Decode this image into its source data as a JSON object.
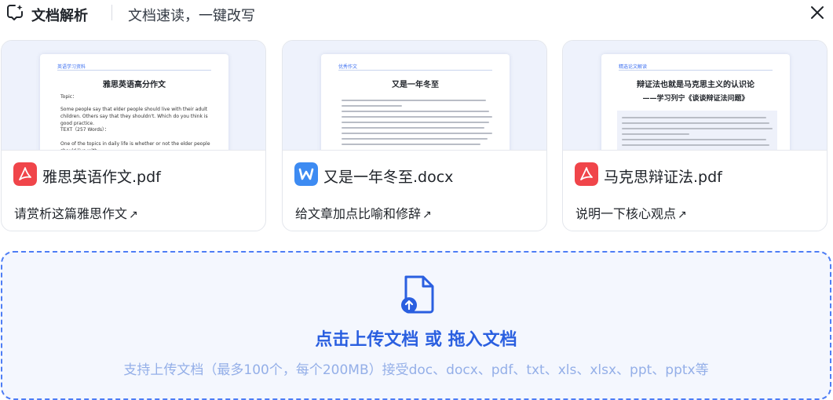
{
  "header": {
    "title": "文档解析",
    "subtitle": "文档速读，一键改写"
  },
  "cards": [
    {
      "file_name": "雅思英语作文.pdf",
      "file_type": "pdf",
      "prompt": "请赏析这篇雅思作文",
      "preview": {
        "tag": "英语学习资料",
        "title": "雅思英语高分作文",
        "lines": [
          "Topic：",
          "Some people say that elder people should live with their adult children. Others say that they shouldn't. Which do you think is good practice.",
          "TEXT（257 Words）：",
          "One of the topics in daily life is whether or not the elder people should live with"
        ]
      }
    },
    {
      "file_name": "又是一年冬至.docx",
      "file_type": "docx",
      "prompt": "给文章加点比喻和修辞",
      "preview": {
        "tag": "优秀作文",
        "title": "又是一年冬至"
      }
    },
    {
      "file_name": "马克思辩证法.pdf",
      "file_type": "pdf",
      "prompt": "说明一下核心观点",
      "preview": {
        "tag": "精选论文解读",
        "title": "辩证法也就是马克思主义的认识论",
        "subtitle": "——学习列宁《谈谈辩证法问题》"
      }
    }
  ],
  "upload": {
    "title": "点击上传文档 或 拖入文档",
    "hint": "支持上传文档（最多100个，每个200MB）接受doc、docx、pdf、txt、xls、xlsx、ppt、pptx等"
  },
  "colors": {
    "accent": "#2a5fe0",
    "pdf": "#f0454a",
    "docx": "#3d8bf2",
    "card_preview_bg": "#eef2fc"
  },
  "icons": {
    "logo": "chat-sparkle-icon",
    "close": "close-icon",
    "pdf": "pdf-icon",
    "docx": "word-icon",
    "arrow": "arrow-up-right-icon",
    "upload": "file-upload-icon"
  }
}
